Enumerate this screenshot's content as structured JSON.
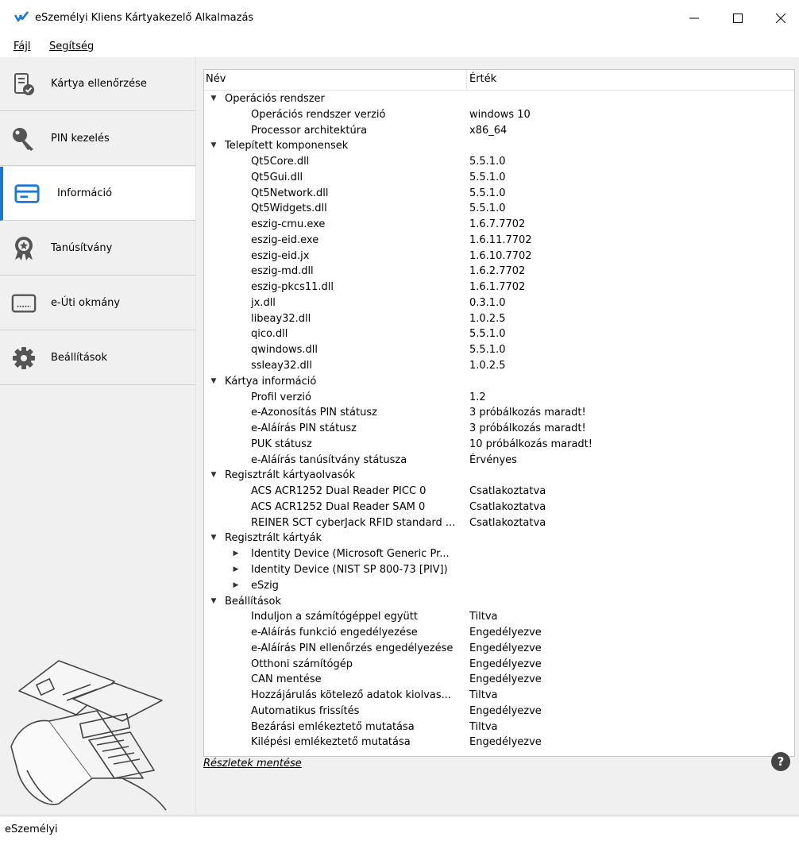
{
  "window": {
    "title": "eSzemélyi Kliens Kártyakezelő Alkalmazás",
    "accent": "#1e78d2"
  },
  "menu": [
    {
      "label": "Fájl"
    },
    {
      "label": "Segítség"
    }
  ],
  "sidebar": {
    "items": [
      {
        "label": "Kártya ellenőrzése",
        "icon": "card-check-icon"
      },
      {
        "label": "PIN kezelés",
        "icon": "key-icon"
      },
      {
        "label": "Információ",
        "icon": "card-icon",
        "active": true
      },
      {
        "label": "Tanúsítvány",
        "icon": "certificate-icon"
      },
      {
        "label": "e-Úti okmány",
        "icon": "passport-icon"
      },
      {
        "label": "Beállítások",
        "icon": "gear-icon"
      }
    ]
  },
  "tree": {
    "columns": [
      "Név",
      "Érték"
    ],
    "rows": [
      {
        "level": 0,
        "expanded": true,
        "name": "Operációs rendszer",
        "value": ""
      },
      {
        "level": 1,
        "name": "Operációs rendszer verzió",
        "value": "windows 10"
      },
      {
        "level": 1,
        "name": "Processor architektúra",
        "value": "x86_64"
      },
      {
        "level": 0,
        "expanded": true,
        "name": "Telepített komponensek",
        "value": ""
      },
      {
        "level": 1,
        "name": "Qt5Core.dll",
        "value": "5.5.1.0"
      },
      {
        "level": 1,
        "name": "Qt5Gui.dll",
        "value": "5.5.1.0"
      },
      {
        "level": 1,
        "name": "Qt5Network.dll",
        "value": "5.5.1.0"
      },
      {
        "level": 1,
        "name": "Qt5Widgets.dll",
        "value": "5.5.1.0"
      },
      {
        "level": 1,
        "name": "eszig-cmu.exe",
        "value": "1.6.7.7702"
      },
      {
        "level": 1,
        "name": "eszig-eid.exe",
        "value": "1.6.11.7702"
      },
      {
        "level": 1,
        "name": "eszig-eid.jx",
        "value": "1.6.10.7702"
      },
      {
        "level": 1,
        "name": "eszig-md.dll",
        "value": "1.6.2.7702"
      },
      {
        "level": 1,
        "name": "eszig-pkcs11.dll",
        "value": "1.6.1.7702"
      },
      {
        "level": 1,
        "name": "jx.dll",
        "value": "0.3.1.0"
      },
      {
        "level": 1,
        "name": "libeay32.dll",
        "value": "1.0.2.5"
      },
      {
        "level": 1,
        "name": "qico.dll",
        "value": "5.5.1.0"
      },
      {
        "level": 1,
        "name": "qwindows.dll",
        "value": "5.5.1.0"
      },
      {
        "level": 1,
        "name": "ssleay32.dll",
        "value": "1.0.2.5"
      },
      {
        "level": 0,
        "expanded": true,
        "name": "Kártya információ",
        "value": ""
      },
      {
        "level": 1,
        "name": "Profil verzió",
        "value": "1.2"
      },
      {
        "level": 1,
        "name": "e-Azonosítás PIN státusz",
        "value": "3 próbálkozás maradt!"
      },
      {
        "level": 1,
        "name": "e-Aláírás PIN státusz",
        "value": "3 próbálkozás maradt!"
      },
      {
        "level": 1,
        "name": "PUK státusz",
        "value": "10 próbálkozás maradt!"
      },
      {
        "level": 1,
        "name": "e-Aláírás tanúsítvány státusza",
        "value": "Érvényes"
      },
      {
        "level": 0,
        "expanded": true,
        "name": "Regisztrált kártyaolvasók",
        "value": ""
      },
      {
        "level": 1,
        "name": "ACS ACR1252 Dual Reader PICC 0",
        "value": "Csatlakoztatva"
      },
      {
        "level": 1,
        "name": "ACS ACR1252 Dual Reader SAM 0",
        "value": "Csatlakoztatva"
      },
      {
        "level": 1,
        "name": "REINER SCT cyberJack RFID standard ...",
        "value": "Csatlakoztatva"
      },
      {
        "level": 0,
        "expanded": true,
        "name": "Regisztrált kártyák",
        "value": ""
      },
      {
        "level": 1,
        "collapsed_child": true,
        "name": "Identity Device (Microsoft Generic Pr...",
        "value": ""
      },
      {
        "level": 1,
        "collapsed_child": true,
        "name": "Identity Device (NIST SP 800-73 [PIV])",
        "value": ""
      },
      {
        "level": 1,
        "collapsed_child": true,
        "name": "eSzig",
        "value": ""
      },
      {
        "level": 0,
        "expanded": true,
        "name": "Beállítások",
        "value": ""
      },
      {
        "level": 1,
        "name": "Induljon a számítógéppel együtt",
        "value": "Tiltva"
      },
      {
        "level": 1,
        "name": "e-Aláírás funkció engedélyezése",
        "value": "Engedélyezve"
      },
      {
        "level": 1,
        "name": "e-Aláírás PIN ellenőrzés engedélyezése",
        "value": "Engedélyezve"
      },
      {
        "level": 1,
        "name": "Otthoni számítógép",
        "value": "Engedélyezve"
      },
      {
        "level": 1,
        "name": "CAN mentése",
        "value": "Engedélyezve"
      },
      {
        "level": 1,
        "name": "Hozzájárulás kötelező adatok kiolvas...",
        "value": "Tiltva"
      },
      {
        "level": 1,
        "name": "Automatikus frissítés",
        "value": "Engedélyezve"
      },
      {
        "level": 1,
        "name": "Bezárási emlékeztető mutatása",
        "value": "Tiltva"
      },
      {
        "level": 1,
        "name": "Kilépési emlékeztető mutatása",
        "value": "Engedélyezve"
      }
    ]
  },
  "footer": {
    "save_link": "Részletek mentése",
    "help_icon": "help-icon"
  },
  "status": {
    "text": "eSzemélyi"
  }
}
